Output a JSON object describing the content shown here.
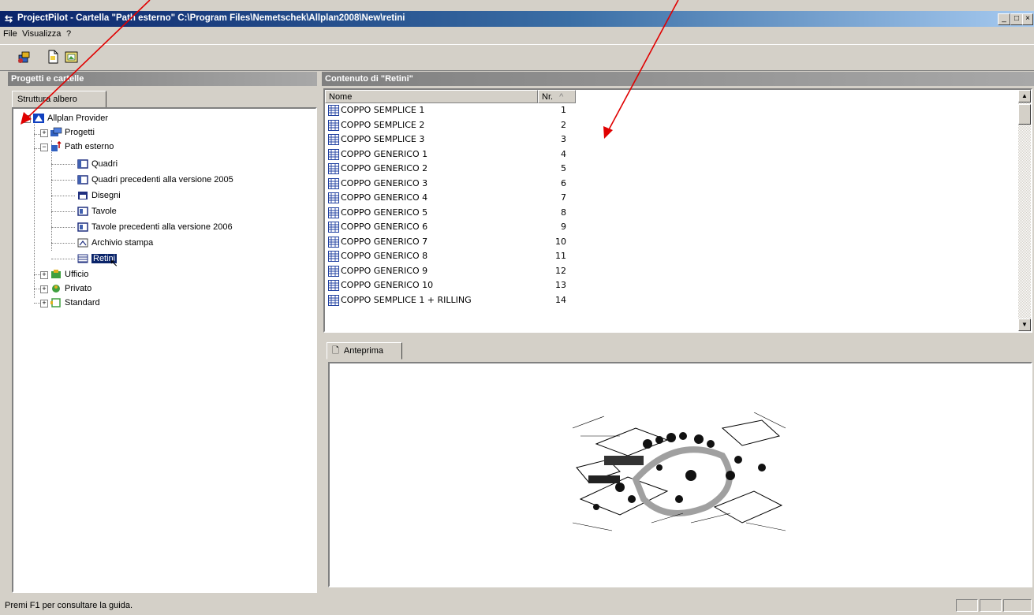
{
  "window": {
    "title": "ProjectPilot - Cartella \"Path esterno\" C:\\Program Files\\Nemetschek\\Allplan2008\\New\\retini",
    "minimize": "_",
    "maximize": "□",
    "close": "×"
  },
  "menu": [
    "File",
    "Visualizza",
    "?"
  ],
  "left_panel": {
    "header": "Progetti e cartelle",
    "tab": "Struttura albero",
    "tree": {
      "root": "Allplan Provider",
      "progetti": "Progetti",
      "path_esterno": "Path esterno",
      "children": [
        "Quadri",
        "Quadri precedenti alla versione 2005",
        "Disegni",
        "Tavole",
        "Tavole precedenti alla versione 2006",
        "Archivio stampa",
        "Retini"
      ],
      "ufficio": "Ufficio",
      "privato": "Privato",
      "standard": "Standard"
    }
  },
  "right_panel": {
    "header": "Contenuto di \"Retini\"",
    "columns": {
      "name": "Nome",
      "nr": "Nr."
    },
    "rows": [
      {
        "name": "COPPO SEMPLICE 1",
        "nr": "1"
      },
      {
        "name": "COPPO SEMPLICE 2",
        "nr": "2"
      },
      {
        "name": "COPPO SEMPLICE 3",
        "nr": "3"
      },
      {
        "name": "COPPO GENERICO 1",
        "nr": "4"
      },
      {
        "name": "COPPO GENERICO 2",
        "nr": "5"
      },
      {
        "name": "COPPO GENERICO 3",
        "nr": "6"
      },
      {
        "name": "COPPO GENERICO 4",
        "nr": "7"
      },
      {
        "name": "COPPO GENERICO 5",
        "nr": "8"
      },
      {
        "name": "COPPO GENERICO 6",
        "nr": "9"
      },
      {
        "name": "COPPO GENERICO 7",
        "nr": "10"
      },
      {
        "name": "COPPO GENERICO 8",
        "nr": "11"
      },
      {
        "name": "COPPO GENERICO 9",
        "nr": "12"
      },
      {
        "name": "COPPO GENERICO 10",
        "nr": "13"
      },
      {
        "name": "COPPO SEMPLICE 1 + RILLING",
        "nr": "14"
      }
    ],
    "preview_tab": "Anteprima"
  },
  "status": {
    "text": "Premi F1 per consultare la guida."
  },
  "annotation_color": "#e00000"
}
